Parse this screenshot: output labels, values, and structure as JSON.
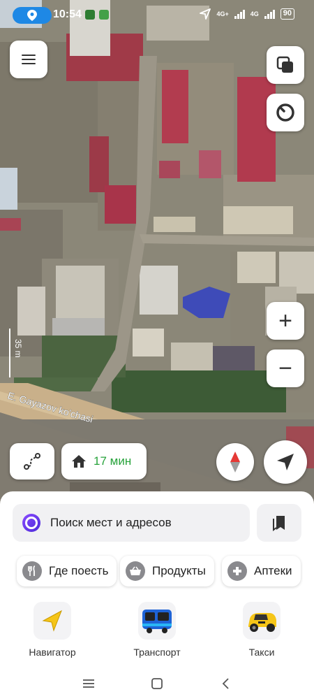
{
  "status_bar": {
    "time": "10:54",
    "network_1": "4G+",
    "network_2": "4G",
    "battery": "90"
  },
  "map": {
    "street_name": "E. Gayazov ko'chasi",
    "scale_label": "35 m"
  },
  "map_controls": {
    "menu_icon": "hamburger-menu-icon",
    "layers_icon": "layers-icon",
    "alice_map_icon": "alice-ring-icon",
    "zoom_in": "+",
    "zoom_out": "−",
    "route_icon": "route-icon",
    "home_icon": "home-icon",
    "eta": "17 мин",
    "compass_icon": "compass-icon",
    "locate_icon": "navigation-arrow-icon"
  },
  "search": {
    "placeholder": "Поиск мест и адресов",
    "bookmarks_icon": "bookmarks-icon"
  },
  "categories": [
    {
      "label": "Где поесть",
      "icon": "fork-knife-icon"
    },
    {
      "label": "Продукты",
      "icon": "basket-icon"
    },
    {
      "label": "Аптеки",
      "icon": "pharmacy-cross-icon"
    }
  ],
  "services": [
    {
      "label": "Навигатор",
      "icon": "navigator-arrow-icon"
    },
    {
      "label": "Транспорт",
      "icon": "bus-icon"
    },
    {
      "label": "Такси",
      "icon": "taxi-car-icon"
    }
  ],
  "colors": {
    "eta_green": "#27a33b",
    "accent_blue": "#1e88e5",
    "compass_red": "#e53935"
  }
}
